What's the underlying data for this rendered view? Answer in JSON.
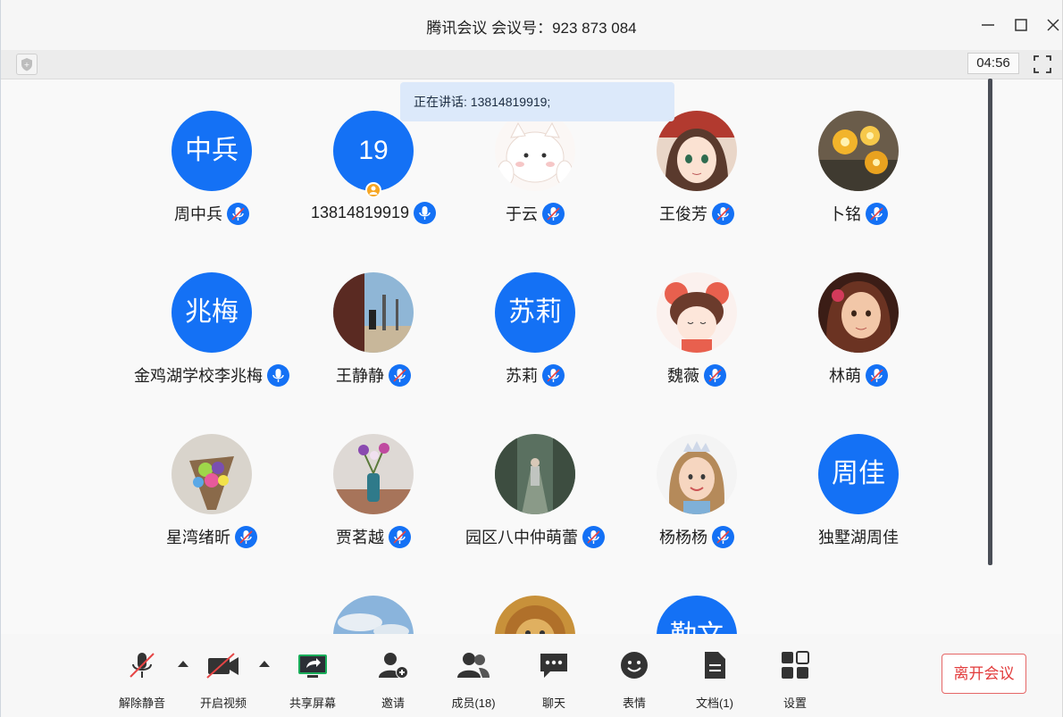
{
  "window": {
    "title": "腾讯会议 会议号：923 873 084",
    "minimize_icon": "minimize-icon",
    "maximize_icon": "maximize-icon",
    "close_icon": "close-icon"
  },
  "status": {
    "timer": "04:56"
  },
  "speaking": "正在讲话: 13814819919;",
  "participants": [
    {
      "name": "周中兵",
      "avatar_text": "中兵",
      "avatar_type": "text",
      "mic": "muted"
    },
    {
      "name": "13814819919",
      "avatar_text": "19",
      "avatar_type": "text",
      "mic": "on",
      "host": true
    },
    {
      "name": "于云",
      "avatar_type": "image",
      "image": "cartoon-cat",
      "mic": "muted"
    },
    {
      "name": "王俊芳",
      "avatar_type": "image",
      "image": "anime-girl",
      "mic": "muted"
    },
    {
      "name": "卜铭",
      "avatar_type": "image",
      "image": "yellow-flowers",
      "mic": "muted"
    },
    {
      "name": "金鸡湖学校李兆梅",
      "avatar_text": "兆梅",
      "avatar_type": "text",
      "mic": "on"
    },
    {
      "name": "王静静",
      "avatar_type": "image",
      "image": "street-photo",
      "mic": "muted"
    },
    {
      "name": "苏莉",
      "avatar_text": "苏莉",
      "avatar_type": "text",
      "mic": "muted"
    },
    {
      "name": "魏薇",
      "avatar_type": "image",
      "image": "cartoon-bear-girl",
      "mic": "muted"
    },
    {
      "name": "林萌",
      "avatar_type": "image",
      "image": "girl-portrait",
      "mic": "muted"
    },
    {
      "name": "星湾绪昕",
      "avatar_type": "image",
      "image": "flower-bouquet",
      "mic": "muted"
    },
    {
      "name": "贾茗越",
      "avatar_type": "image",
      "image": "vase-flowers",
      "mic": "muted"
    },
    {
      "name": "园区八中仲萌蕾",
      "avatar_type": "image",
      "image": "forest-path",
      "mic": "muted"
    },
    {
      "name": "杨杨杨",
      "avatar_type": "image",
      "image": "girl-tiara",
      "mic": "muted"
    },
    {
      "name": "独墅湖周佳",
      "avatar_text": "周佳",
      "avatar_type": "text",
      "mic": "none"
    },
    {
      "name": "",
      "avatar_type": "image",
      "image": "sky-photo",
      "mic": "none"
    },
    {
      "name": "",
      "avatar_type": "image",
      "image": "lion-photo",
      "mic": "none"
    },
    {
      "name": "",
      "avatar_text": "勤文",
      "avatar_type": "text",
      "mic": "none"
    }
  ],
  "toolbar": {
    "mute": "解除静音",
    "video": "开启视频",
    "share": "共享屏幕",
    "invite": "邀请",
    "members": "成员(18)",
    "chat": "聊天",
    "emoji": "表情",
    "docs": "文档(1)",
    "settings": "设置",
    "leave": "离开会议"
  },
  "colors": {
    "accent": "#1471f5",
    "leave": "#e23b3b",
    "share_green": "#1aad5a",
    "mute_red": "#e64545"
  }
}
